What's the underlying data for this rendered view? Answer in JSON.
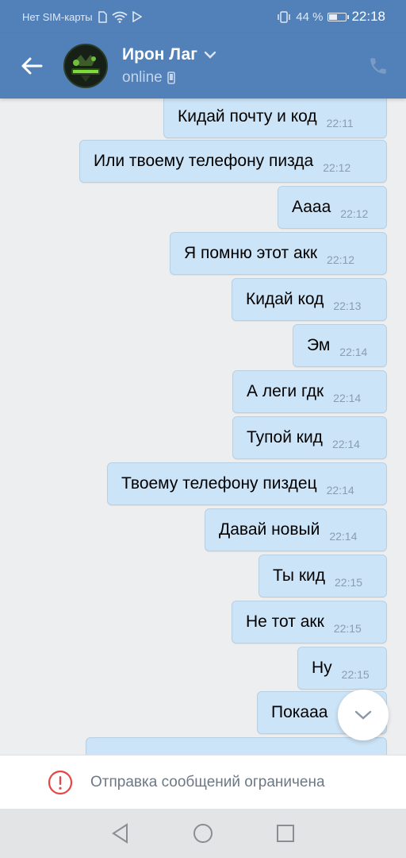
{
  "status_bar": {
    "carrier": "Нет SIM-карты",
    "battery_percent": "44 %",
    "battery_level": 0.44,
    "time": "22:18"
  },
  "header": {
    "title": "Ирон Лаг",
    "subtitle": "online",
    "accent": "#5181b8"
  },
  "messages": [
    {
      "text": "Кидай почту и код",
      "time": "22:11"
    },
    {
      "text": "Или твоему телефону пизда",
      "time": "22:12"
    },
    {
      "text": "Аааа",
      "time": "22:12"
    },
    {
      "text": "Я помню этот акк",
      "time": "22:12"
    },
    {
      "text": "Кидай код",
      "time": "22:13"
    },
    {
      "text": "Эм",
      "time": "22:14"
    },
    {
      "text": "А леги гдк",
      "time": "22:14"
    },
    {
      "text": "Тупой кид",
      "time": "22:14"
    },
    {
      "text": "Твоему телефону пиздец",
      "time": "22:14"
    },
    {
      "text": "Давай новый",
      "time": "22:14"
    },
    {
      "text": "Ты кид",
      "time": "22:15"
    },
    {
      "text": "Не тот акк",
      "time": "22:15"
    },
    {
      "text": "Ну",
      "time": "22:15"
    },
    {
      "text": "Покааа",
      "time": ""
    },
    {
      "text": "",
      "time": ""
    }
  ],
  "restriction": {
    "text": "Отправка сообщений ограничена",
    "icon": "alert-circle-icon",
    "color": "#e64646"
  },
  "nav": {
    "back_icon": "triangle-back-icon",
    "home_icon": "circle-home-icon",
    "recents_icon": "square-recents-icon"
  }
}
